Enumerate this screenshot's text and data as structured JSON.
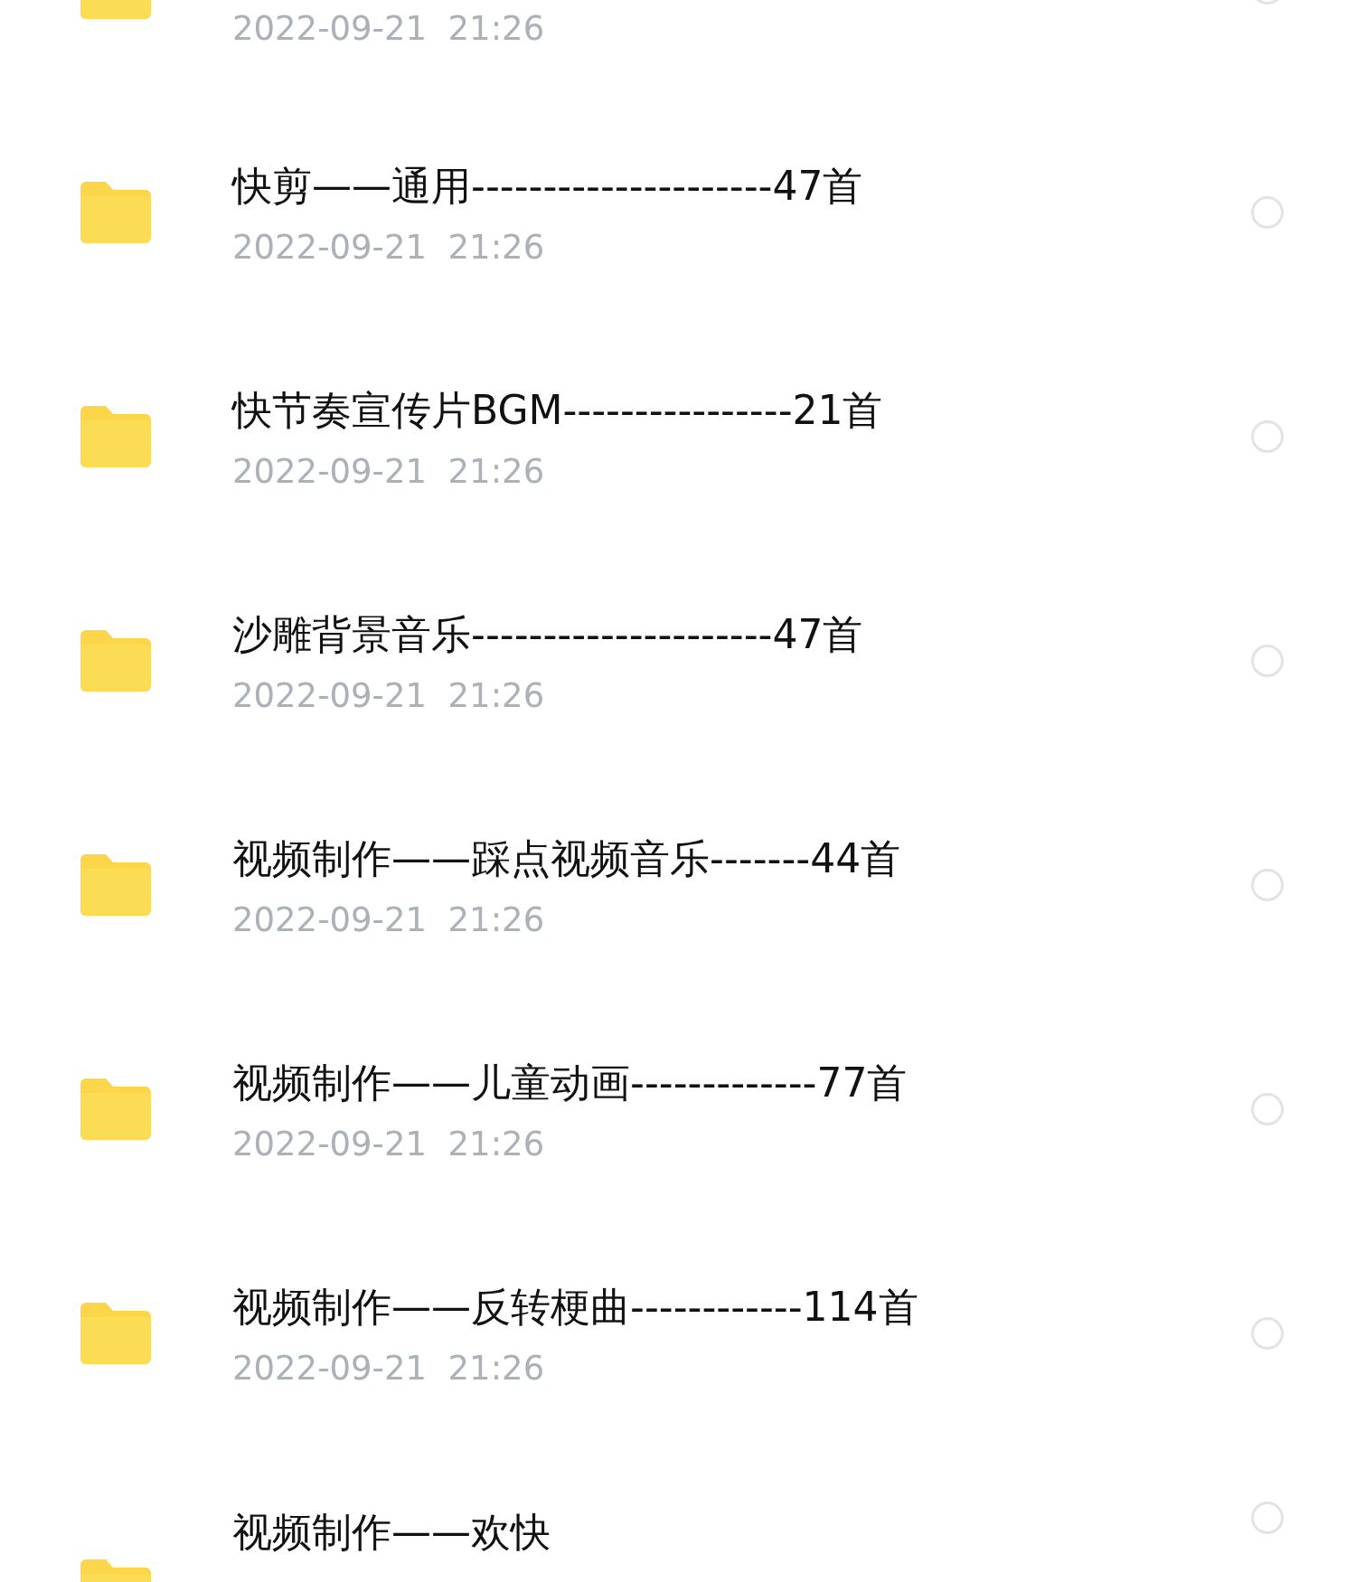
{
  "files": [
    {
      "date": "2022-09-21  21:26",
      "selected": false
    },
    {
      "name": "快剪——通用---------------------47首",
      "date": "2022-09-21  21:26",
      "selected": false
    },
    {
      "name": "快节奏宣传片BGM----------------21首",
      "date": "2022-09-21  21:26",
      "selected": false
    },
    {
      "name": "沙雕背景音乐---------------------47首",
      "date": "2022-09-21  21:26",
      "selected": false
    },
    {
      "name": "视频制作——踩点视频音乐-------44首",
      "date": "2022-09-21  21:26",
      "selected": false
    },
    {
      "name": "视频制作——儿童动画-------------77首",
      "date": "2022-09-21  21:26",
      "selected": false
    },
    {
      "name": "视频制作——反转梗曲------------114首",
      "date": "2022-09-21  21:26",
      "selected": false
    },
    {
      "name": "视频制作——欢快",
      "selected": false
    }
  ]
}
